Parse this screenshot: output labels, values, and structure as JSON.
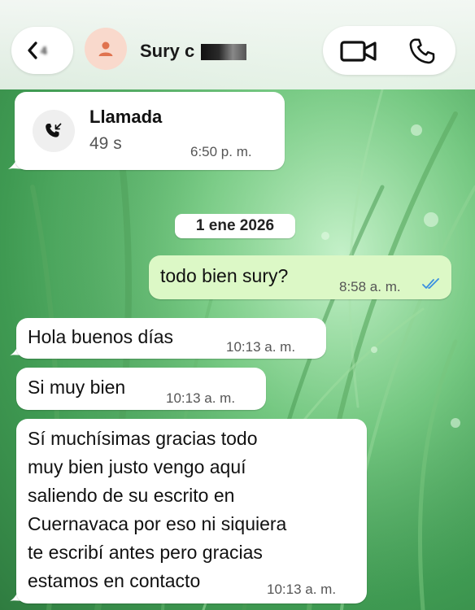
{
  "header": {
    "back_count": "4",
    "contact_name": "Sury c",
    "avatar_icon": "person-icon",
    "video_icon": "video-camera-icon",
    "phone_icon": "phone-icon"
  },
  "call": {
    "title": "Llamada",
    "duration": "49 s",
    "time": "6:50 p. m.",
    "icon": "incoming-call-icon"
  },
  "date_separator": "1 ene 2026",
  "messages": [
    {
      "direction": "out",
      "text": "todo bien sury?",
      "time": "8:58 a. m.",
      "status": "read"
    },
    {
      "direction": "in",
      "text": "Hola buenos días",
      "time": "10:13 a. m."
    },
    {
      "direction": "in",
      "text": "Si muy bien",
      "time": "10:13 a. m."
    },
    {
      "direction": "in",
      "lines": [
        "Sí muchísimas gracias todo",
        "muy bien justo vengo aquí",
        "saliendo de su escrito en",
        "Cuernavaca por eso ni siquiera",
        "te escribí antes pero gracias",
        "estamos en contacto"
      ],
      "time": "10:13 a. m."
    }
  ],
  "colors": {
    "outgoing_bubble": "#dcf8c6",
    "incoming_bubble": "#ffffff",
    "read_ticks": "#3b8fe0",
    "avatar_bg": "#f9d9cc",
    "avatar_fg": "#e0734f"
  }
}
